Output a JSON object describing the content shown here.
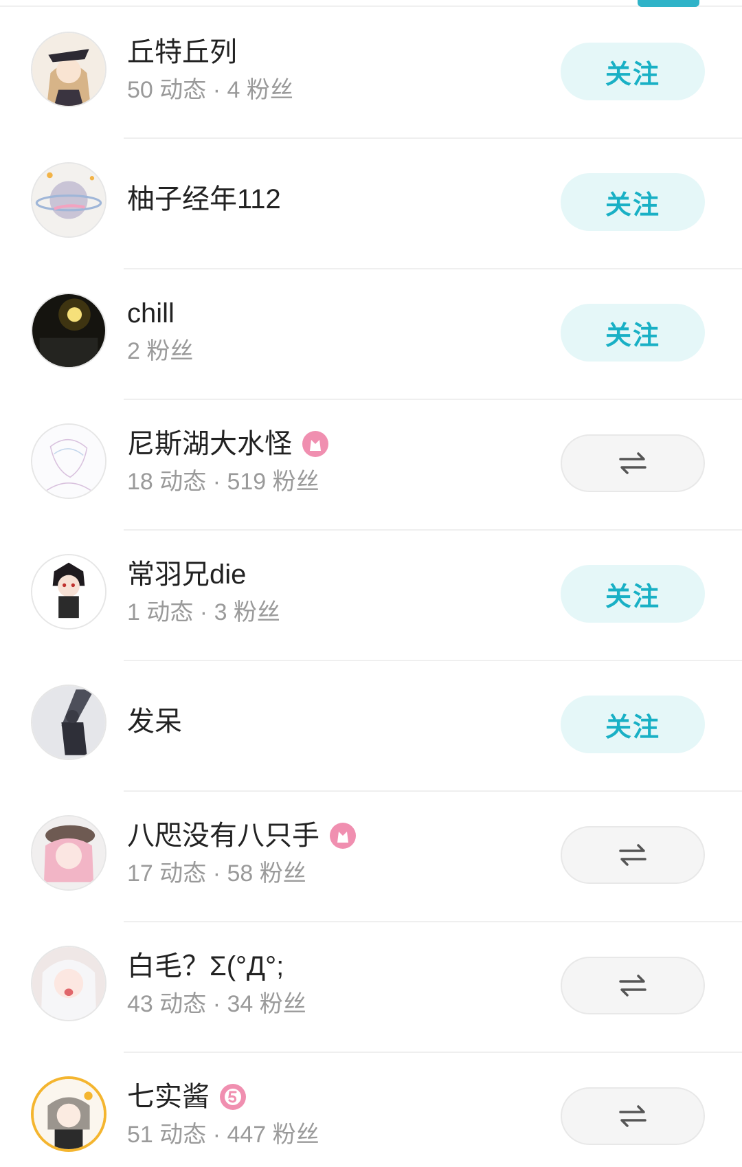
{
  "colors": {
    "accent": "#19b0c5",
    "follow_bg": "#e5f7f8",
    "mutual_bg": "#f5f5f5",
    "name_text": "#222222",
    "stats_text": "#9a9a9a",
    "badge_pink": "#f08fb0"
  },
  "users": [
    {
      "name": "丘特丘列",
      "stats": "50 动态 · 4 粉丝",
      "badge": null,
      "button": {
        "type": "follow",
        "label": "关注"
      },
      "avatar_icon": "anime-girl-hat-avatar"
    },
    {
      "name": "柚子经年112",
      "stats": "",
      "badge": null,
      "button": {
        "type": "follow",
        "label": "关注"
      },
      "avatar_icon": "planet-avatar"
    },
    {
      "name": "chill",
      "stats": "2 粉丝",
      "badge": null,
      "button": {
        "type": "follow",
        "label": "关注"
      },
      "avatar_icon": "street-lamp-avatar"
    },
    {
      "name": "尼斯湖大水怪",
      "stats": "18 动态 · 519 粉丝",
      "badge": "2021-badge-icon",
      "button": {
        "type": "mutual",
        "icon": "mutual-follow-icon"
      },
      "avatar_icon": "sketch-avatar"
    },
    {
      "name": "常羽兄die",
      "stats": "1 动态 · 3 粉丝",
      "badge": null,
      "button": {
        "type": "follow",
        "label": "关注"
      },
      "avatar_icon": "chibi-avatar"
    },
    {
      "name": "发呆",
      "stats": "",
      "badge": null,
      "button": {
        "type": "follow",
        "label": "关注"
      },
      "avatar_icon": "mech-avatar"
    },
    {
      "name": "八咫没有八只手",
      "stats": "17 动态 · 58 粉丝",
      "badge": "2021-badge-icon",
      "button": {
        "type": "mutual",
        "icon": "mutual-follow-icon"
      },
      "avatar_icon": "pink-hair-avatar"
    },
    {
      "name": "白毛？Σ(°Д°;",
      "stats": "43 动态 · 34 粉丝",
      "badge": null,
      "button": {
        "type": "mutual",
        "icon": "mutual-follow-icon"
      },
      "avatar_icon": "white-hair-avatar"
    },
    {
      "name": "七实酱",
      "stats": "51 动态 · 447 粉丝",
      "badge": "level-5-badge-icon",
      "button": {
        "type": "mutual",
        "icon": "mutual-follow-icon"
      },
      "avatar_icon": "gold-frame-avatar"
    }
  ]
}
